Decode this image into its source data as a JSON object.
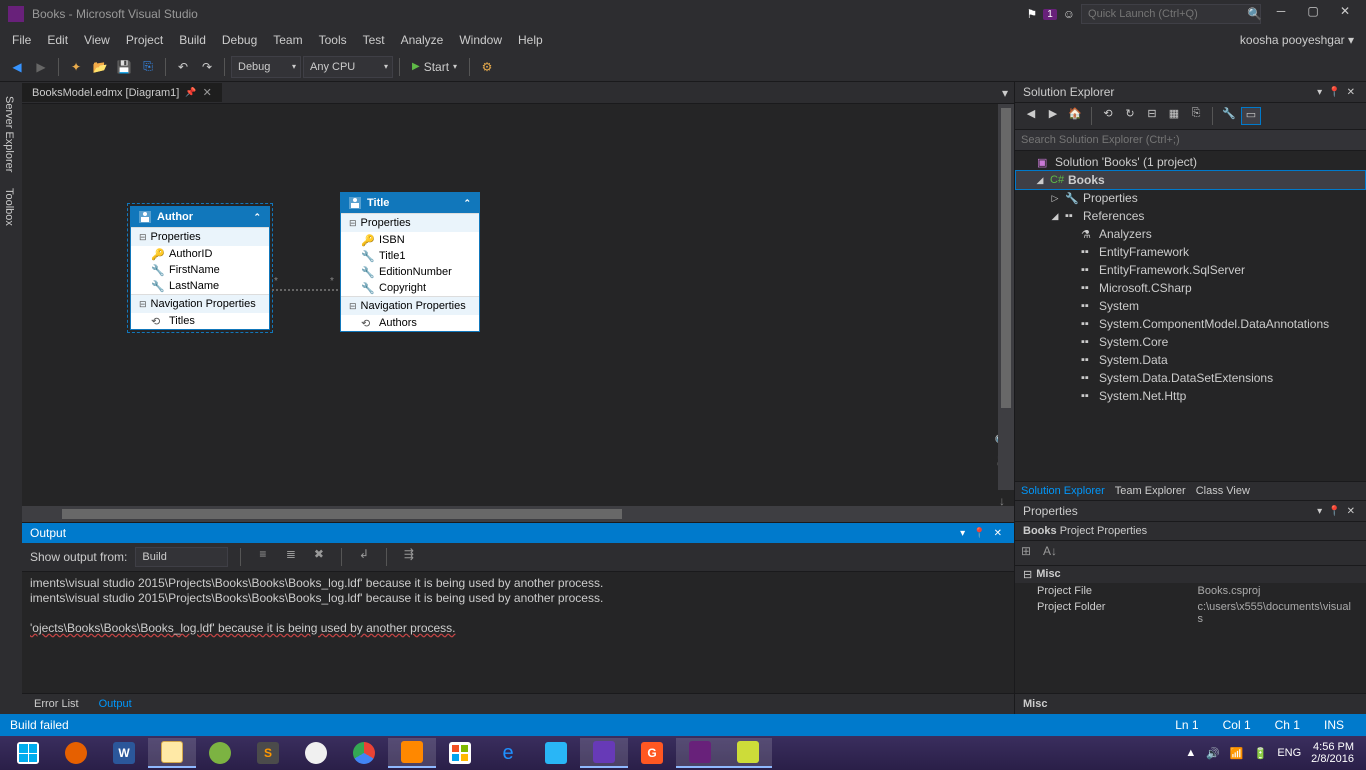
{
  "titleBar": {
    "title": "Books - Microsoft Visual Studio",
    "notificationCount": "1",
    "quickLaunchPlaceholder": "Quick Launch (Ctrl+Q)"
  },
  "menuBar": {
    "items": [
      "File",
      "Edit",
      "View",
      "Project",
      "Build",
      "Debug",
      "Team",
      "Tools",
      "Test",
      "Analyze",
      "Window",
      "Help"
    ],
    "user": "koosha pooyeshgar"
  },
  "toolbar": {
    "config": "Debug",
    "platform": "Any CPU",
    "start": "Start"
  },
  "sideTabs": [
    "Server Explorer",
    "Toolbox"
  ],
  "editor": {
    "tab": "BooksModel.edmx [Diagram1]"
  },
  "entities": {
    "author": {
      "name": "Author",
      "propsHeader": "Properties",
      "navHeader": "Navigation Properties",
      "props": [
        "AuthorID",
        "FirstName",
        "LastName"
      ],
      "navs": [
        "Titles"
      ]
    },
    "title": {
      "name": "Title",
      "propsHeader": "Properties",
      "navHeader": "Navigation Properties",
      "props": [
        "ISBN",
        "Title1",
        "EditionNumber",
        "Copyright"
      ],
      "navs": [
        "Authors"
      ]
    }
  },
  "output": {
    "title": "Output",
    "showFromLabel": "Show output from:",
    "showFrom": "Build",
    "lines": [
      "iments\\visual studio 2015\\Projects\\Books\\Books\\Books_log.ldf' because it is being used by another process.",
      "iments\\visual studio 2015\\Projects\\Books\\Books\\Books_log.ldf' because it is being used by another process.",
      "",
      "'ojects\\Books\\Books\\Books_log.ldf' because it is being used by another process."
    ],
    "tabs": [
      "Error List",
      "Output"
    ],
    "activeTab": 1
  },
  "solutionExplorer": {
    "title": "Solution Explorer",
    "searchPlaceholder": "Search Solution Explorer (Ctrl+;)",
    "solution": "Solution 'Books' (1 project)",
    "project": "Books",
    "nodes": {
      "properties": "Properties",
      "references": "References",
      "refs": [
        "Analyzers",
        "EntityFramework",
        "EntityFramework.SqlServer",
        "Microsoft.CSharp",
        "System",
        "System.ComponentModel.DataAnnotations",
        "System.Core",
        "System.Data",
        "System.Data.DataSetExtensions",
        "System.Net.Http"
      ]
    },
    "tabs": [
      "Solution Explorer",
      "Team Explorer",
      "Class View"
    ]
  },
  "properties": {
    "title": "Properties",
    "target": "Books",
    "targetType": "Project Properties",
    "misc": "Misc",
    "rows": {
      "projectFile": {
        "k": "Project File",
        "v": "Books.csproj"
      },
      "projectFolder": {
        "k": "Project Folder",
        "v": "c:\\users\\x555\\documents\\visual s"
      }
    },
    "descLabel": "Misc"
  },
  "statusBar": {
    "buildStatus": "Build failed",
    "ln": "Ln 1",
    "col": "Col 1",
    "ch": "Ch 1",
    "ins": "INS"
  },
  "taskbar": {
    "lang": "ENG",
    "time": "4:56 PM",
    "date": "2/8/2016"
  }
}
